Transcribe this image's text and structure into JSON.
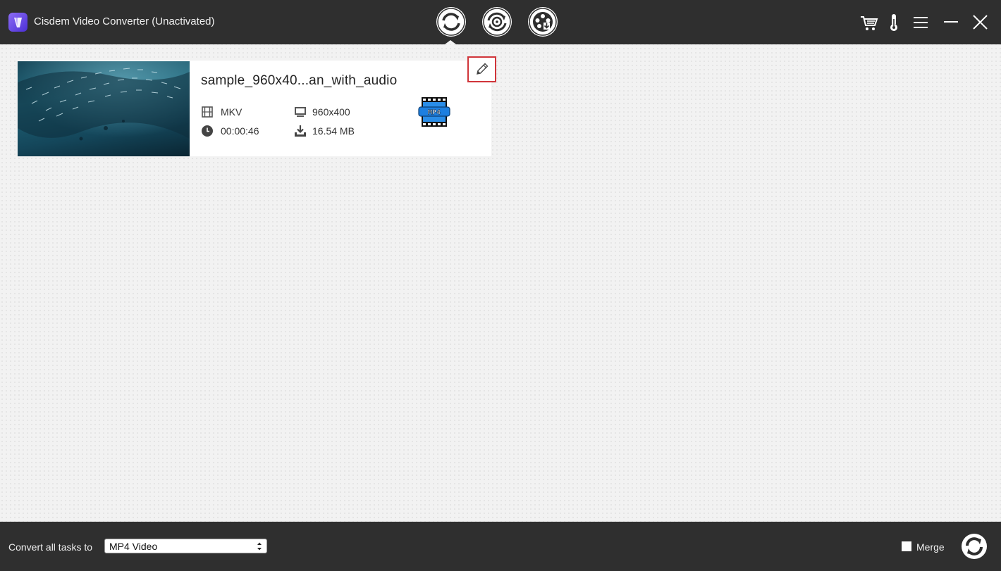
{
  "window": {
    "title": "Cisdem Video Converter (Unactivated)",
    "icons": [
      "app-logo-icon",
      "cart-icon",
      "thermometer-icon",
      "menu-icon",
      "minimize-icon",
      "close-icon"
    ]
  },
  "modes": [
    {
      "name": "convert",
      "icon": "convert-icon",
      "active": true
    },
    {
      "name": "rip-dvd",
      "icon": "dvd-rip-icon",
      "active": false
    },
    {
      "name": "download",
      "icon": "download-reel-icon",
      "active": false
    }
  ],
  "task": {
    "name": "sample_960x40...an_with_audio",
    "container": "MKV",
    "duration": "00:00:46",
    "resolution": "960x400",
    "file_size": "16.54 MB",
    "output_format_badge": "MP4"
  },
  "bottom": {
    "convert_all_label": "Convert all tasks to",
    "selected_format": "MP4 Video",
    "merge_label": "Merge",
    "merge_checked": false
  },
  "colors": {
    "titlebar": "#2f2f2f",
    "edit_highlight": "#d0353a",
    "badge_blue": "#1d7fe0"
  }
}
